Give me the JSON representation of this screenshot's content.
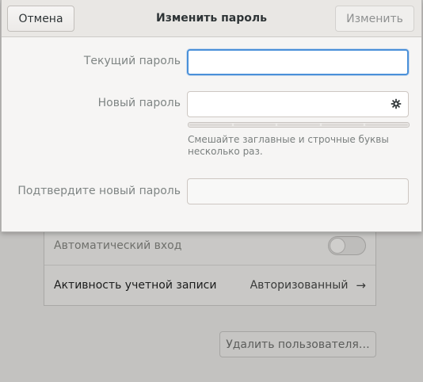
{
  "dialog": {
    "title": "Изменить пароль",
    "cancel_label": "Отмена",
    "confirm_label": "Изменить",
    "current_password_label": "Текущий пароль",
    "current_password_value": "",
    "new_password_label": "Новый пароль",
    "new_password_value": "",
    "new_password_icon": "gear-icon",
    "strength_segments": 5,
    "strength_level": 0,
    "hint": "Смешайте заглавные и строчные буквы несколько раз.",
    "confirm_password_label": "Подтвердите новый пароль",
    "confirm_password_value": ""
  },
  "background": {
    "auto_login_label": "Автоматический вход",
    "auto_login_enabled": false,
    "account_activity_label": "Активность учетной записи",
    "account_activity_value": "Авторизованный",
    "delete_user_label": "Удалить пользователя…"
  },
  "colors": {
    "focus_accent": "#4a90d9",
    "dialog_bg": "#f6f5f4",
    "headerbar_bg": "#e9e7e4",
    "backdrop": "#c3c2c0"
  }
}
